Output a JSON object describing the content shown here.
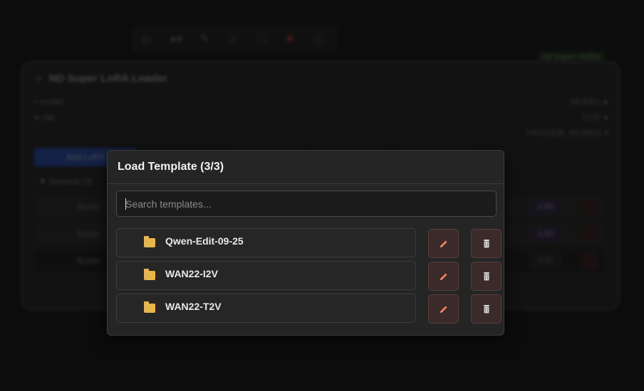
{
  "background": {
    "toolbar_icons": [
      "play-icon",
      "circle-dropdown-icon",
      "pen-icon",
      "bell-icon",
      "fit-icon",
      "trash-icon",
      "info-icon"
    ],
    "node_tag": "nd-super-nodes",
    "node": {
      "title": "ND Super LoRA Loader",
      "inputs": [
        "model",
        "clip"
      ],
      "outputs": [
        "MODEL",
        "CLIP",
        "TRIGGER_WORDS"
      ],
      "add_button": "Add LoRA",
      "section": "General (3)",
      "rows": [
        {
          "file": "flux\\lo",
          "strength": "0.50"
        },
        {
          "file": "flux\\lo",
          "strength": "1.00"
        },
        {
          "file": "flux\\lo",
          "strength": "0.50"
        }
      ]
    }
  },
  "modal": {
    "title": "Load Template (3/3)",
    "search_placeholder": "Search templates...",
    "templates": [
      {
        "name": "Qwen-Edit-09-25"
      },
      {
        "name": "WAN22-I2V"
      },
      {
        "name": "WAN22-T2V"
      }
    ]
  },
  "colors": {
    "folder": "#e8b54d",
    "edit_icon": "#f08050",
    "delete_icon": "#d8d8d8",
    "action_bg": "#3b2a2a"
  }
}
